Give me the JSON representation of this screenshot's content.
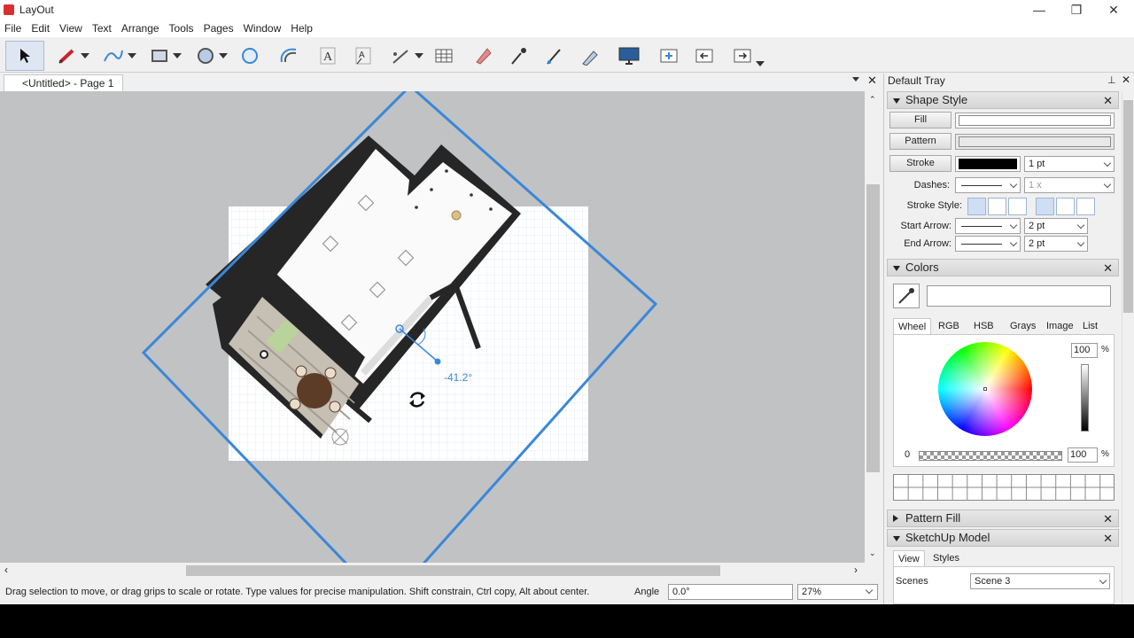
{
  "window": {
    "title": "LayOut",
    "min": "—",
    "max": "❐",
    "close": "✕"
  },
  "menu": [
    "File",
    "Edit",
    "View",
    "Text",
    "Arrange",
    "Tools",
    "Pages",
    "Window",
    "Help"
  ],
  "document": {
    "tab_label": "<Untitled> - Page 1"
  },
  "canvas": {
    "rotation_angle_label": "-41.2°"
  },
  "status": {
    "hint": "Drag selection to move, or drag grips to scale or rotate. Type values for precise manipulation. Shift constrain, Ctrl copy, Alt about center.",
    "angle_label": "Angle",
    "angle_value": "0.0°",
    "zoom_value": "27%"
  },
  "tray": {
    "title": "Default Tray",
    "shape_style": {
      "title": "Shape Style",
      "fill_label": "Fill",
      "pattern_label": "Pattern",
      "stroke_label": "Stroke",
      "stroke_width": "1 pt",
      "dashes_label": "Dashes:",
      "dash_scale": "1 x",
      "stroke_style_label": "Stroke Style:",
      "start_arrow_label": "Start Arrow:",
      "start_arrow_size": "2 pt",
      "end_arrow_label": "End Arrow:",
      "end_arrow_size": "2 pt",
      "stroke_color": "#000000"
    },
    "colors": {
      "title": "Colors",
      "tabs": [
        "Wheel",
        "RGB",
        "HSB",
        "Grays",
        "Image",
        "List"
      ],
      "active_tab": "Wheel",
      "brightness_value": "100",
      "brightness_unit": "%",
      "opacity_min": "0",
      "opacity_value": "100",
      "opacity_unit": "%"
    },
    "pattern_fill": {
      "title": "Pattern Fill"
    },
    "sketchup_model": {
      "title": "SketchUp Model",
      "tabs": [
        "View",
        "Styles"
      ],
      "scenes_label": "Scenes",
      "scene_value": "Scene 3"
    }
  },
  "colors": {
    "accent_blue": "#3a87d9",
    "canvas_bg": "#c0c2c3",
    "paper": "#ffffff"
  }
}
